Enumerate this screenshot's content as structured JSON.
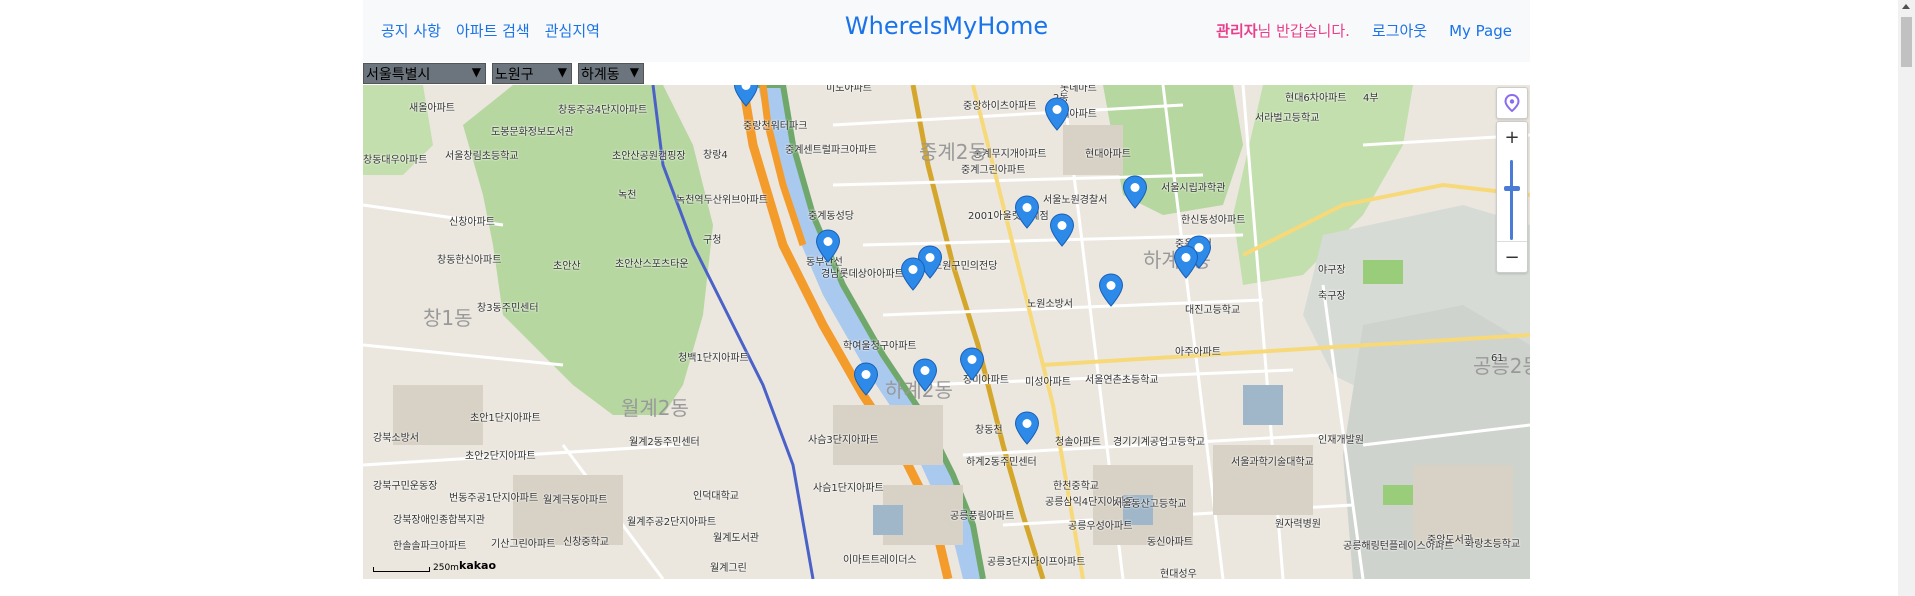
{
  "header": {
    "nav_left": [
      "공지 사항",
      "아파트 검색",
      "관심지역"
    ],
    "brand": "WhereIsMyHome",
    "admin_name": "관리자",
    "welcome_suffix": "님 반갑습니다.",
    "logout": "로그아웃",
    "mypage": "My Page"
  },
  "filters": {
    "city": "서울특별시",
    "district": "노원구",
    "dong": "하계동"
  },
  "map": {
    "scale_label": "250m",
    "provider": "kakao",
    "marker_count": 15,
    "zoom_level_fraction": 0.35,
    "colors": {
      "marker": "#2d8ae8",
      "river": "#a9c9ee",
      "park": "#b6d7a0",
      "highway": "#f39b2b"
    },
    "labels": [
      "미도아파트",
      "롯데마트",
      "현대6차아파트",
      "새올아파트",
      "창동주공4단지아파트",
      "도봉문화정보도서관",
      "초안산공원캠핑장",
      "서울창림초등학교",
      "창동대우아파트",
      "중랑천워터파크",
      "중계센트럴파크아파트",
      "중앙하이츠아파트",
      "중계무지개아파트",
      "현대아파트",
      "서라벌고등학교",
      "중계그린아파트",
      "중계동성당",
      "녹천역두산위브아파트",
      "2001아울렛중계점",
      "서울노원경찰서",
      "서울시립과학관",
      "한신동성아파트",
      "중움공원",
      "신창아파트",
      "창동한신아파트",
      "초안산",
      "초안산스포츠타운",
      "경남롯데상아아파트",
      "노원구민의전당",
      "야구장",
      "축구장",
      "창3동주민센터",
      "대진고등학교",
      "노원소방서",
      "청백1단지아파트",
      "하계2동",
      "월계2동",
      "학여울청구아파트",
      "아주아파트",
      "장미아파트",
      "미성아파트",
      "서울연촌초등학교",
      "초안1단지아파트",
      "강북소방서",
      "청솔아파트",
      "경기기계공업고등학교",
      "인재개발원",
      "초안2단지아파트",
      "월계2동주민센터",
      "사슴3단지아파트",
      "하계2동주민센터",
      "서울과학기술대학교",
      "강북구민운동장",
      "번동주공1단지아파트",
      "월계극동아파트",
      "사슴1단지아파트",
      "한천중학교",
      "공릉삼익4단지아파트",
      "서울동산고등학교",
      "인덕대학교",
      "공릉풍림아파트",
      "공릉우성아파트",
      "원자력병원",
      "월계주공2단지아파트",
      "강북장애인종합복지관",
      "한솔솔파크아파트",
      "기산그린아파트",
      "신창중학교",
      "월계도서관",
      "동신아파트",
      "공릉해링턴플레이스아파트",
      "중앙도서관",
      "화랑초등학교",
      "이마트트레이더스",
      "공릉3단지라이프아파트",
      "현대성우",
      "월계그린",
      "공릉2동",
      "창1동",
      "하계1동",
      "중계2동",
      "현대아파트",
      "창랑4",
      "동부간선",
      "녹천",
      "창동천",
      "구청",
      "2동",
      "4부",
      "61",
      "3",
      "대",
      "중계4"
    ]
  }
}
